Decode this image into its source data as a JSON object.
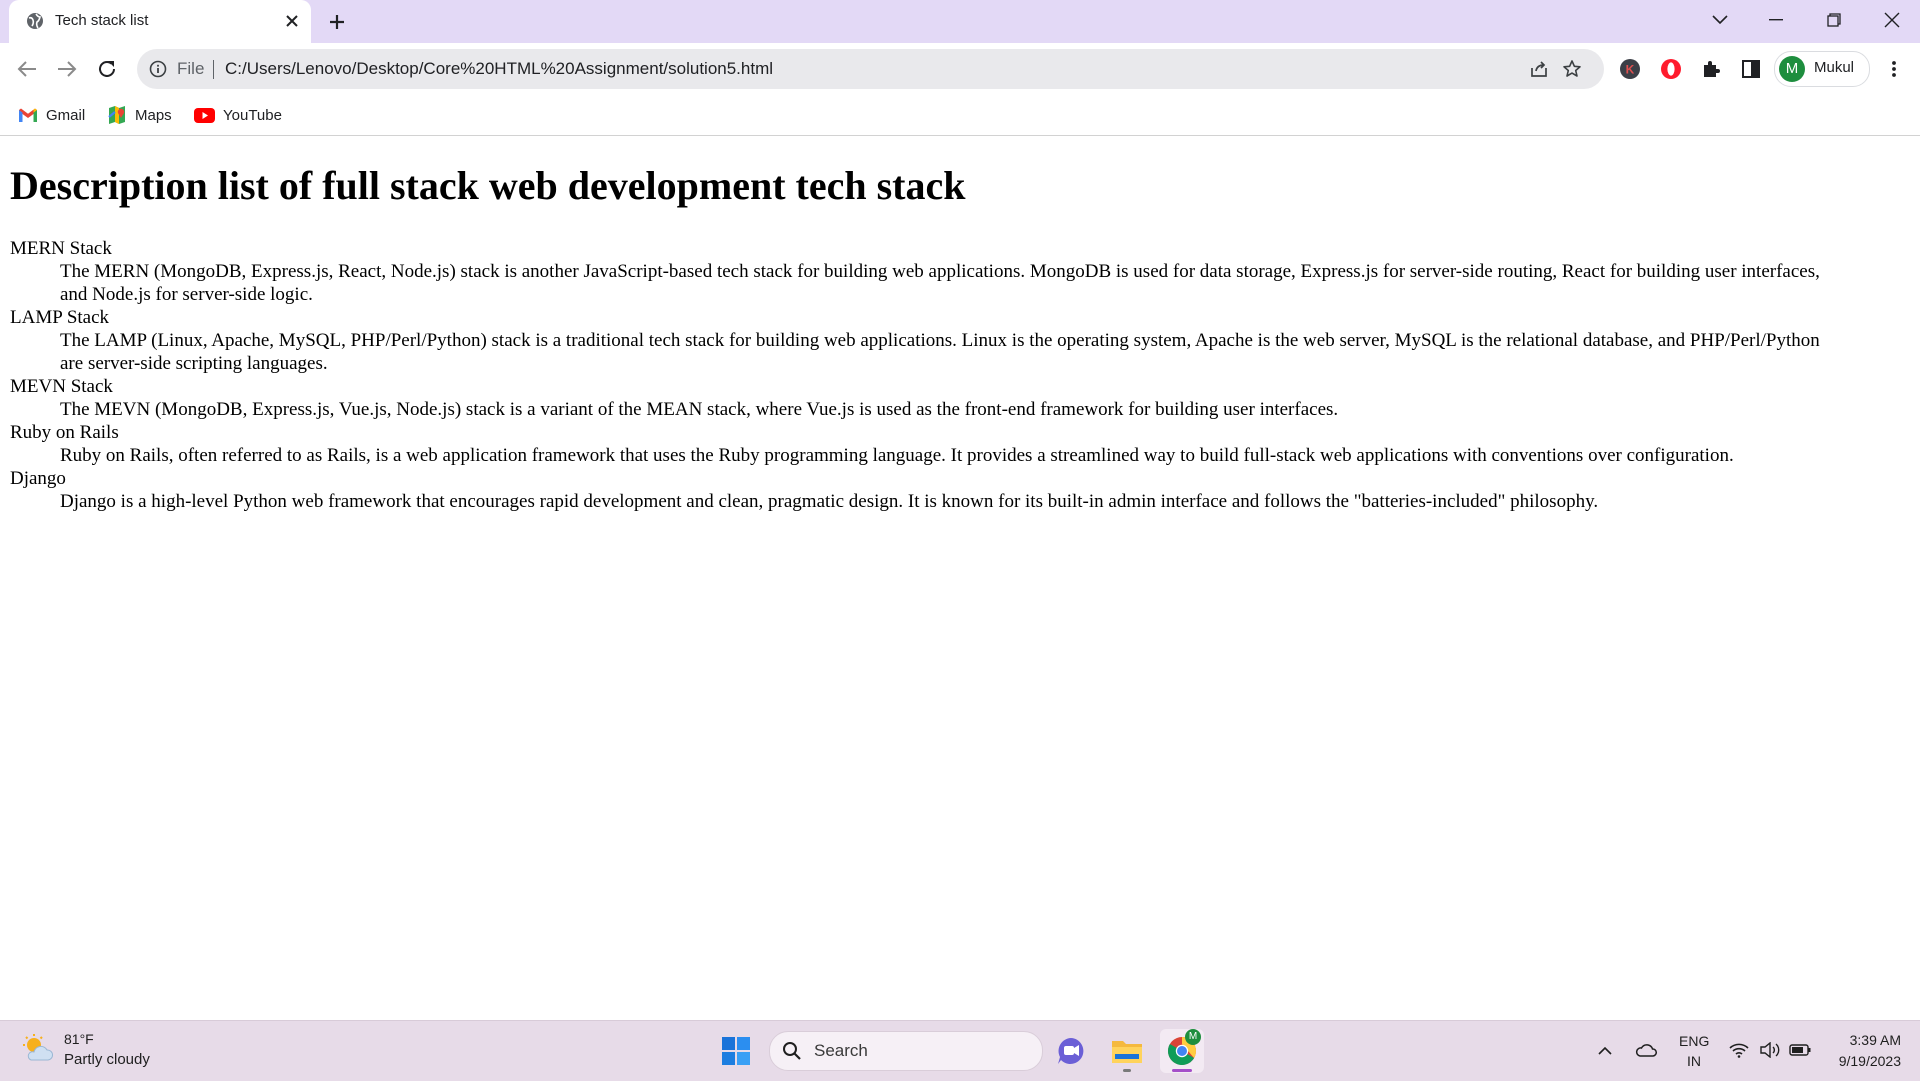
{
  "browser": {
    "tab": {
      "title": "Tech stack list"
    },
    "address": {
      "scheme_label": "File",
      "url": "C:/Users/Lenovo/Desktop/Core%20HTML%20Assignment/solution5.html"
    },
    "profile": {
      "initial": "M",
      "name": "Mukul"
    },
    "extensions": [
      {
        "icon": "k-extension-icon",
        "label": "K"
      }
    ],
    "bookmarks": [
      {
        "label": "Gmail",
        "icon": "gmail-icon"
      },
      {
        "label": "Maps",
        "icon": "maps-icon"
      },
      {
        "label": "YouTube",
        "icon": "youtube-icon"
      }
    ]
  },
  "page": {
    "heading": "Description list of full stack web development tech stack",
    "items": [
      {
        "term": "MERN Stack",
        "description": "The MERN (MongoDB, Express.js, React, Node.js) stack is another JavaScript-based tech stack for building web applications. MongoDB is used for data storage, Express.js for server-side routing, React for building user interfaces, and Node.js for server-side logic."
      },
      {
        "term": "LAMP Stack",
        "description": "The LAMP (Linux, Apache, MySQL, PHP/Perl/Python) stack is a traditional tech stack for building web applications. Linux is the operating system, Apache is the web server, MySQL is the relational database, and PHP/Perl/Python are server-side scripting languages."
      },
      {
        "term": "MEVN Stack",
        "description": "The MEVN (MongoDB, Express.js, Vue.js, Node.js) stack is a variant of the MEAN stack, where Vue.js is used as the front-end framework for building user interfaces."
      },
      {
        "term": "Ruby on Rails",
        "description": "Ruby on Rails, often referred to as Rails, is a web application framework that uses the Ruby programming language. It provides a streamlined way to build full-stack web applications with conventions over configuration."
      },
      {
        "term": "Django",
        "description": "Django is a high-level Python web framework that encourages rapid development and clean, pragmatic design. It is known for its built-in admin interface and follows the \"batteries-included\" philosophy."
      }
    ]
  },
  "taskbar": {
    "weather": {
      "temp": "81°F",
      "condition": "Partly cloudy"
    },
    "search": {
      "placeholder": "Search"
    },
    "tray": {
      "lang_top": "ENG",
      "lang_bottom": "IN"
    },
    "clock": {
      "time": "3:39 AM",
      "date": "9/19/2023"
    },
    "chrome_badge": "M"
  },
  "colors": {
    "tab_strip": "#e3d9f6",
    "taskbar": "#e7dbe8",
    "avatar": "#1e8e3e",
    "youtube_red": "#ff0000"
  }
}
